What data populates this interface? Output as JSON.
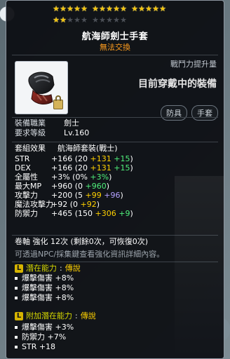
{
  "item": {
    "name": "航海師劍士手套",
    "trade_status": "無法交換"
  },
  "stars": {
    "row1_filled": 15,
    "row1_total": 15,
    "row2_filled": 2,
    "row2_total": 10
  },
  "power": {
    "label": "戰鬥力提升量",
    "message": "目前穿戴中的裝備"
  },
  "tags": [
    "防具",
    "手套"
  ],
  "info": {
    "job_label": "裝備職業",
    "job_value": "劍士",
    "level_label": "要求等級",
    "level_value": "Lv.160"
  },
  "set_effect": {
    "label": "套組效果",
    "value": "航海師套裝(戰士)"
  },
  "stats": [
    {
      "name": "STR",
      "base": "+166",
      "paren_open": "(20",
      "y": "+131",
      "g": "+15",
      "b": "",
      "paren_close": ")"
    },
    {
      "name": "DEX",
      "base": "+166",
      "paren_open": "(20",
      "y": "+131",
      "g": "+15",
      "b": "",
      "paren_close": ")"
    },
    {
      "name": "全屬性",
      "base": "+3%",
      "paren_open": "(0%",
      "y": "",
      "g": "+3%",
      "b": "",
      "paren_close": ")"
    },
    {
      "name": "最大MP",
      "base": "+960",
      "paren_open": "(0",
      "y": "",
      "g": "+960",
      "b": "",
      "paren_close": ")"
    },
    {
      "name": "攻擊力",
      "base": "+200",
      "paren_open": "(5",
      "y": "+99",
      "g": "",
      "b": "+96",
      "paren_close": ")"
    },
    {
      "name": "魔法攻擊力",
      "base": "+92",
      "paren_open": "(0",
      "y": "+92",
      "g": "",
      "b": "",
      "paren_close": ")"
    },
    {
      "name": "防禦力",
      "base": "+465",
      "paren_open": "(150",
      "y": "+306",
      "g": "+9",
      "b": "",
      "paren_close": ")"
    }
  ],
  "upgrade_text": "卷軸 強化 12次 (剩餘0次，可恢復0次)",
  "note": "可透過NPC/採集鍵查看強化資訊詳細內容。",
  "potential": {
    "badge": "L",
    "title": "潛在能力",
    "tier": "傳說",
    "lines": [
      "爆擊傷害 +8%",
      "爆擊傷害 +8%",
      "爆擊傷害 +8%"
    ]
  },
  "additional_potential": {
    "badge": "L",
    "title": "附加潛在能力",
    "tier": "傳說",
    "lines": [
      "爆擊傷害 +3%",
      "防禦力 +7%",
      "STR +18"
    ]
  }
}
